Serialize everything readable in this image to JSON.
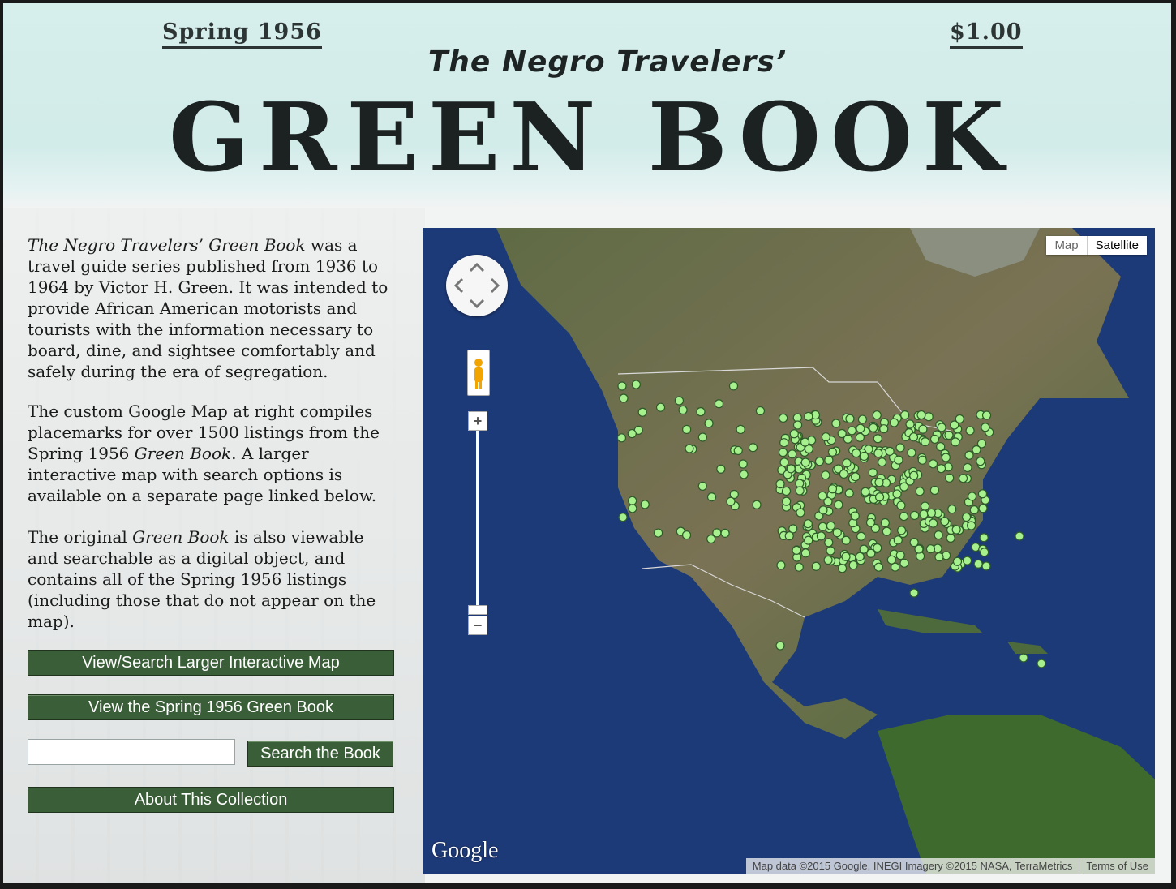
{
  "header": {
    "season": "Spring 1956",
    "price": "$1.00",
    "subtitle": "The Negro Travelers’",
    "title": "GREEN BOOK"
  },
  "intro": {
    "p1_title": "The Negro Travelers’ Green Book",
    "p1_rest": " was a travel guide series published from 1936 to 1964 by Victor H. Green. It was intended to provide African American motorists and tourists with the information necessary to board, dine, and sightsee comfortably and safely during the era of segregation.",
    "p2_a": "The custom Google Map at right compiles placemarks for over 1500 listings from the Spring 1956 ",
    "p2_b": "Green Book",
    "p2_c": ". A larger interactive map with search options is available on a separate page linked below.",
    "p3_a": "The original ",
    "p3_b": "Green Book",
    "p3_c": " is also viewable and searchable as a digital object, and contains all of the Spring 1956 listings (including those that do not appear on the map)."
  },
  "buttons": {
    "larger_map": "View/Search Larger Interactive Map",
    "view_book": "View the Spring 1956 Green Book",
    "search_book": "Search the Book",
    "about": "About This Collection"
  },
  "search": {
    "value": "",
    "placeholder": ""
  },
  "map": {
    "type_map": "Map",
    "type_satellite": "Satellite",
    "logo": "Google",
    "attribution": "Map data ©2015 Google, INEGI Imagery ©2015 NASA, TerraMetrics",
    "terms": "Terms of Use",
    "zoom_in": "+",
    "zoom_out": "−",
    "colors": {
      "ocean": "#1d3a78",
      "placemark": "#a6f08e"
    }
  }
}
